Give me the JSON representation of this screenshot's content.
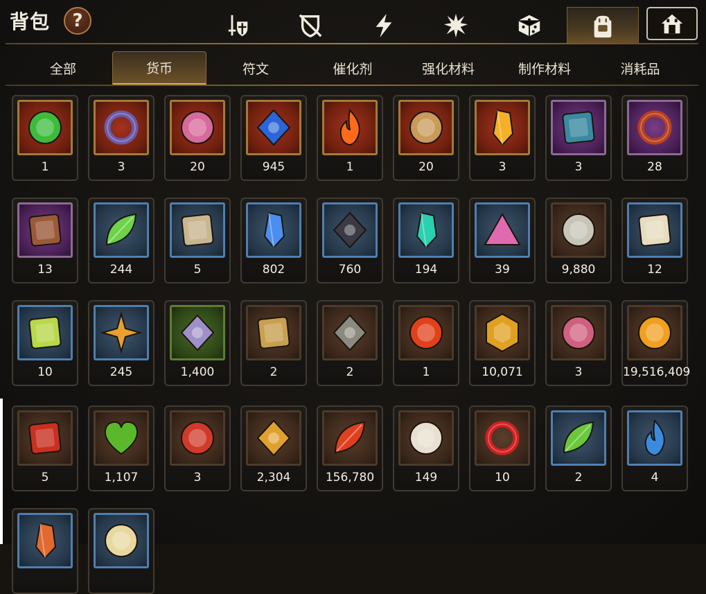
{
  "header": {
    "title": "背包",
    "help_label": "?"
  },
  "category_tabs": [
    {
      "icon": "sword-shield-icon",
      "active": false
    },
    {
      "icon": "broken-shield-icon",
      "active": false
    },
    {
      "icon": "lightning-icon",
      "active": false
    },
    {
      "icon": "burst-icon",
      "active": false
    },
    {
      "icon": "dice-icon",
      "active": false
    },
    {
      "icon": "backpack-icon",
      "active": true
    },
    {
      "icon": "house-icon",
      "active": false
    }
  ],
  "sub_tabs": [
    {
      "label": "全部",
      "active": false
    },
    {
      "label": "货币",
      "active": true
    },
    {
      "label": "符文",
      "active": false
    },
    {
      "label": "催化剂",
      "active": false
    },
    {
      "label": "强化材料",
      "active": false
    },
    {
      "label": "制作材料",
      "active": false
    },
    {
      "label": "消耗品",
      "active": false
    }
  ],
  "colors": {
    "accent_gold": "#d8b062",
    "text": "#f4efe4",
    "background": "#17140f"
  },
  "items": [
    {
      "icon": "clover-amulet-icon",
      "rarity": "gold",
      "color": "#3dbb3a",
      "count": "1"
    },
    {
      "icon": "ring-coin-icon",
      "rarity": "gold",
      "color": "#6b5aa8",
      "count": "3"
    },
    {
      "icon": "pink-medallion-icon",
      "rarity": "gold",
      "color": "#d66a9a",
      "count": "20"
    },
    {
      "icon": "eye-crest-icon",
      "rarity": "gold",
      "color": "#2a66d8",
      "count": "945"
    },
    {
      "icon": "flame-icon",
      "rarity": "gold",
      "color": "#ff6a1a",
      "count": "1"
    },
    {
      "icon": "demon-mask-icon",
      "rarity": "gold",
      "color": "#c99a5a",
      "count": "20"
    },
    {
      "icon": "amber-crystal-icon",
      "rarity": "gold",
      "color": "#f5b02a",
      "count": "3"
    },
    {
      "icon": "scroll-bundle-icon",
      "rarity": "purple",
      "color": "#3a8aa0",
      "count": "3"
    },
    {
      "icon": "crescent-flower-icon",
      "rarity": "purple",
      "color": "#b8401f",
      "count": "28"
    },
    {
      "icon": "gift-box-icon",
      "rarity": "purple",
      "color": "#9a5a3a",
      "count": "13"
    },
    {
      "icon": "green-leaf-icon",
      "rarity": "blue",
      "color": "#6ed24a",
      "count": "244"
    },
    {
      "icon": "open-book-icon",
      "rarity": "blue",
      "color": "#c8b690",
      "count": "5"
    },
    {
      "icon": "blue-crystal-icon",
      "rarity": "blue",
      "color": "#4a8ef0",
      "count": "802"
    },
    {
      "icon": "black-stone-icon",
      "rarity": "blue",
      "color": "#3a3a44",
      "count": "760"
    },
    {
      "icon": "teal-crystal-icon",
      "rarity": "blue",
      "color": "#2ad0b0",
      "count": "194"
    },
    {
      "icon": "pink-ore-icon",
      "rarity": "blue",
      "color": "#e06ab0",
      "count": "39"
    },
    {
      "icon": "silver-coin-icon",
      "rarity": "brown",
      "color": "#c8c4b8",
      "count": "9,880"
    },
    {
      "icon": "card-scroll-icon",
      "rarity": "blue",
      "color": "#e8dcc0",
      "count": "12"
    },
    {
      "icon": "crown-card-icon",
      "rarity": "blue",
      "color": "#b8d84a",
      "count": "10"
    },
    {
      "icon": "compass-star-icon",
      "rarity": "blue",
      "color": "#e8a030",
      "count": "245"
    },
    {
      "icon": "fist-crest-icon",
      "rarity": "green",
      "color": "#a090c8",
      "count": "1,400"
    },
    {
      "icon": "ticket-icon",
      "rarity": "brown",
      "color": "#c8a050",
      "count": "2"
    },
    {
      "icon": "stone-compass-icon",
      "rarity": "brown",
      "color": "#8a8a80",
      "count": "2"
    },
    {
      "icon": "lava-orb-icon",
      "rarity": "brown",
      "color": "#e0401a",
      "count": "1"
    },
    {
      "icon": "gold-hexagon-icon",
      "rarity": "brown",
      "color": "#e0a020",
      "count": "10,071"
    },
    {
      "icon": "pod-creature-icon",
      "rarity": "brown",
      "color": "#d06080",
      "count": "3"
    },
    {
      "icon": "sun-coin-icon",
      "rarity": "brown",
      "color": "#f0a020",
      "count": "19,516,409"
    },
    {
      "icon": "banner-icon",
      "rarity": "brown",
      "color": "#c83020",
      "count": "5"
    },
    {
      "icon": "green-heart-icon",
      "rarity": "brown",
      "color": "#5ab82a",
      "count": "1,107"
    },
    {
      "icon": "red-cap-seal-icon",
      "rarity": "brown",
      "color": "#d03a2a",
      "count": "3"
    },
    {
      "icon": "fist-medal-icon",
      "rarity": "brown",
      "color": "#e0a030",
      "count": "2,304"
    },
    {
      "icon": "red-leaves-icon",
      "rarity": "brown",
      "color": "#e04020",
      "count": "156,780"
    },
    {
      "icon": "knight-piece-icon",
      "rarity": "brown",
      "color": "#e8e0d0",
      "count": "149"
    },
    {
      "icon": "red-band-icon",
      "rarity": "brown",
      "color": "#d02020",
      "count": "10"
    },
    {
      "icon": "green-cocoon-icon",
      "rarity": "blue",
      "color": "#6ac83a",
      "count": "2"
    },
    {
      "icon": "blue-drop-icon",
      "rarity": "blue",
      "color": "#3a8ae0",
      "count": "4"
    },
    {
      "icon": "ember-gem-icon",
      "rarity": "blue",
      "color": "#e06a30",
      "count": ""
    },
    {
      "icon": "potion-bottle-icon",
      "rarity": "blue",
      "color": "#e8d8a0",
      "count": ""
    }
  ]
}
